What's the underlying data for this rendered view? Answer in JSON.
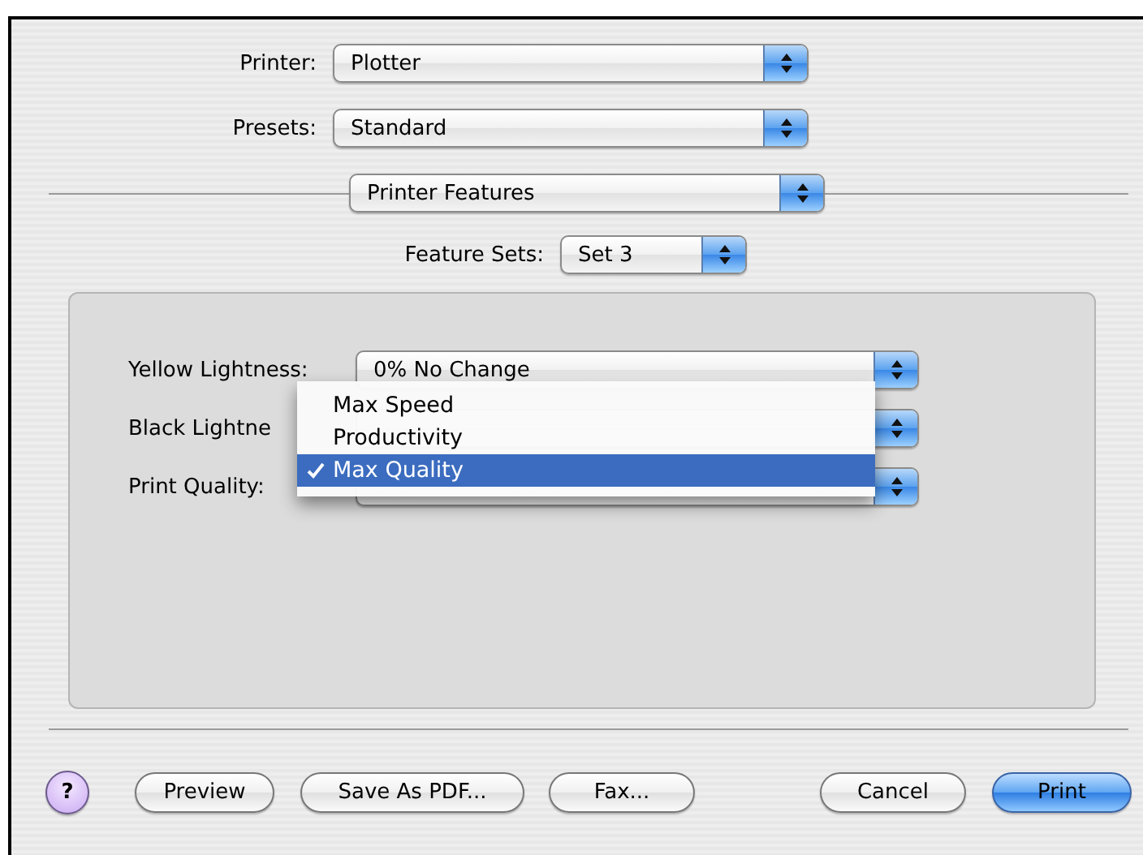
{
  "printer": {
    "label": "Printer:",
    "value": "Plotter"
  },
  "presets": {
    "label": "Presets:",
    "value": "Standard"
  },
  "panel_menu": {
    "value": "Printer Features"
  },
  "feature_sets": {
    "label": "Feature Sets:",
    "value": "Set 3"
  },
  "settings": [
    {
      "label": "Yellow Lightness:",
      "value": "0% No Change"
    },
    {
      "label": "Black Lightne"
    },
    {
      "label": "Print Quality:"
    }
  ],
  "open_menu": {
    "items": [
      {
        "label": "Max Speed",
        "selected": false
      },
      {
        "label": "Productivity",
        "selected": false
      },
      {
        "label": "Max Quality",
        "selected": true
      }
    ]
  },
  "help_button": {
    "label": "?"
  },
  "buttons": [
    {
      "label": "Preview",
      "kind": "normal"
    },
    {
      "label": "Save As PDF...",
      "kind": "normal"
    },
    {
      "label": "Fax...",
      "kind": "normal"
    },
    {
      "label": "Cancel",
      "kind": "normal"
    },
    {
      "label": "Print",
      "kind": "default"
    }
  ]
}
